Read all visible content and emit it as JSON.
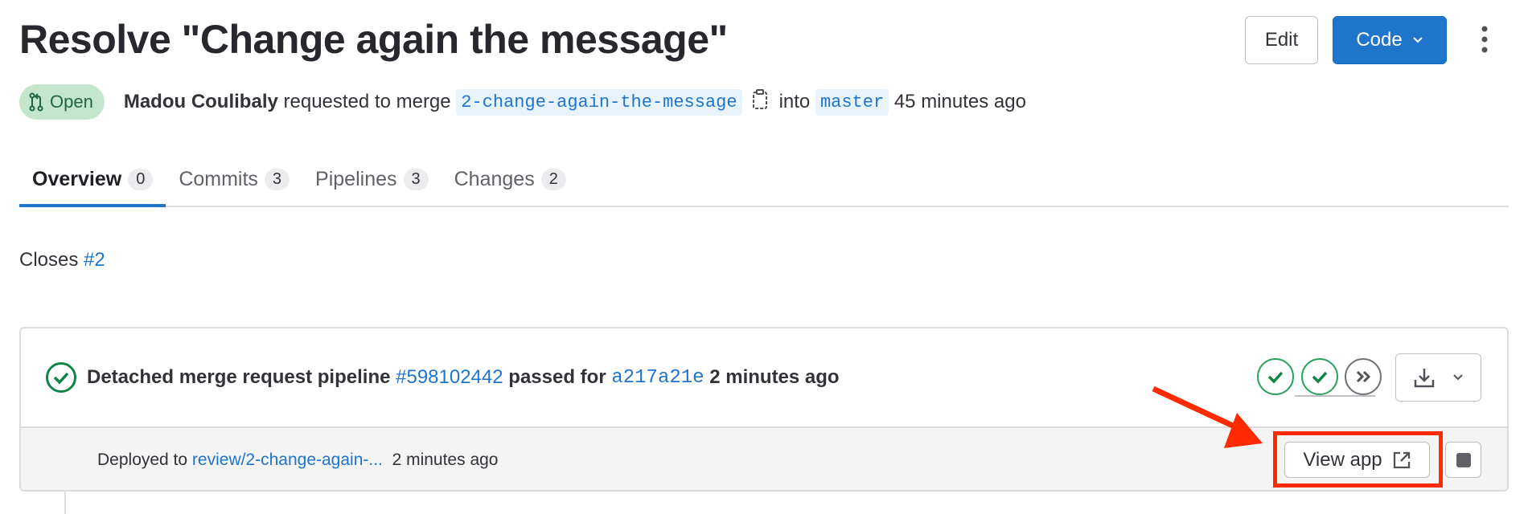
{
  "header": {
    "title": "Resolve \"Change again the message\"",
    "edit_label": "Edit",
    "code_label": "Code"
  },
  "meta": {
    "status": "Open",
    "author": "Madou Coulibaly",
    "action": "requested to merge",
    "source_branch": "2-change-again-the-message",
    "into": "into",
    "target_branch": "master",
    "time": "45 minutes ago"
  },
  "tabs": [
    {
      "label": "Overview",
      "count": "0"
    },
    {
      "label": "Commits",
      "count": "3"
    },
    {
      "label": "Pipelines",
      "count": "3"
    },
    {
      "label": "Changes",
      "count": "2"
    }
  ],
  "description": {
    "prefix": "Closes",
    "issue_link": "#2"
  },
  "pipeline": {
    "text1": "Detached merge request pipeline",
    "id": "#598102442",
    "text2": "passed for",
    "commit": "a217a21e",
    "time": "2 minutes ago",
    "status": "passed"
  },
  "deployment": {
    "prefix": "Deployed to",
    "environment": "review/2-change-again-...",
    "time": "2 minutes ago",
    "view_app_label": "View app"
  },
  "colors": {
    "accent": "#1f75cb",
    "success": "#108548",
    "annotation": "#ff2a00"
  }
}
